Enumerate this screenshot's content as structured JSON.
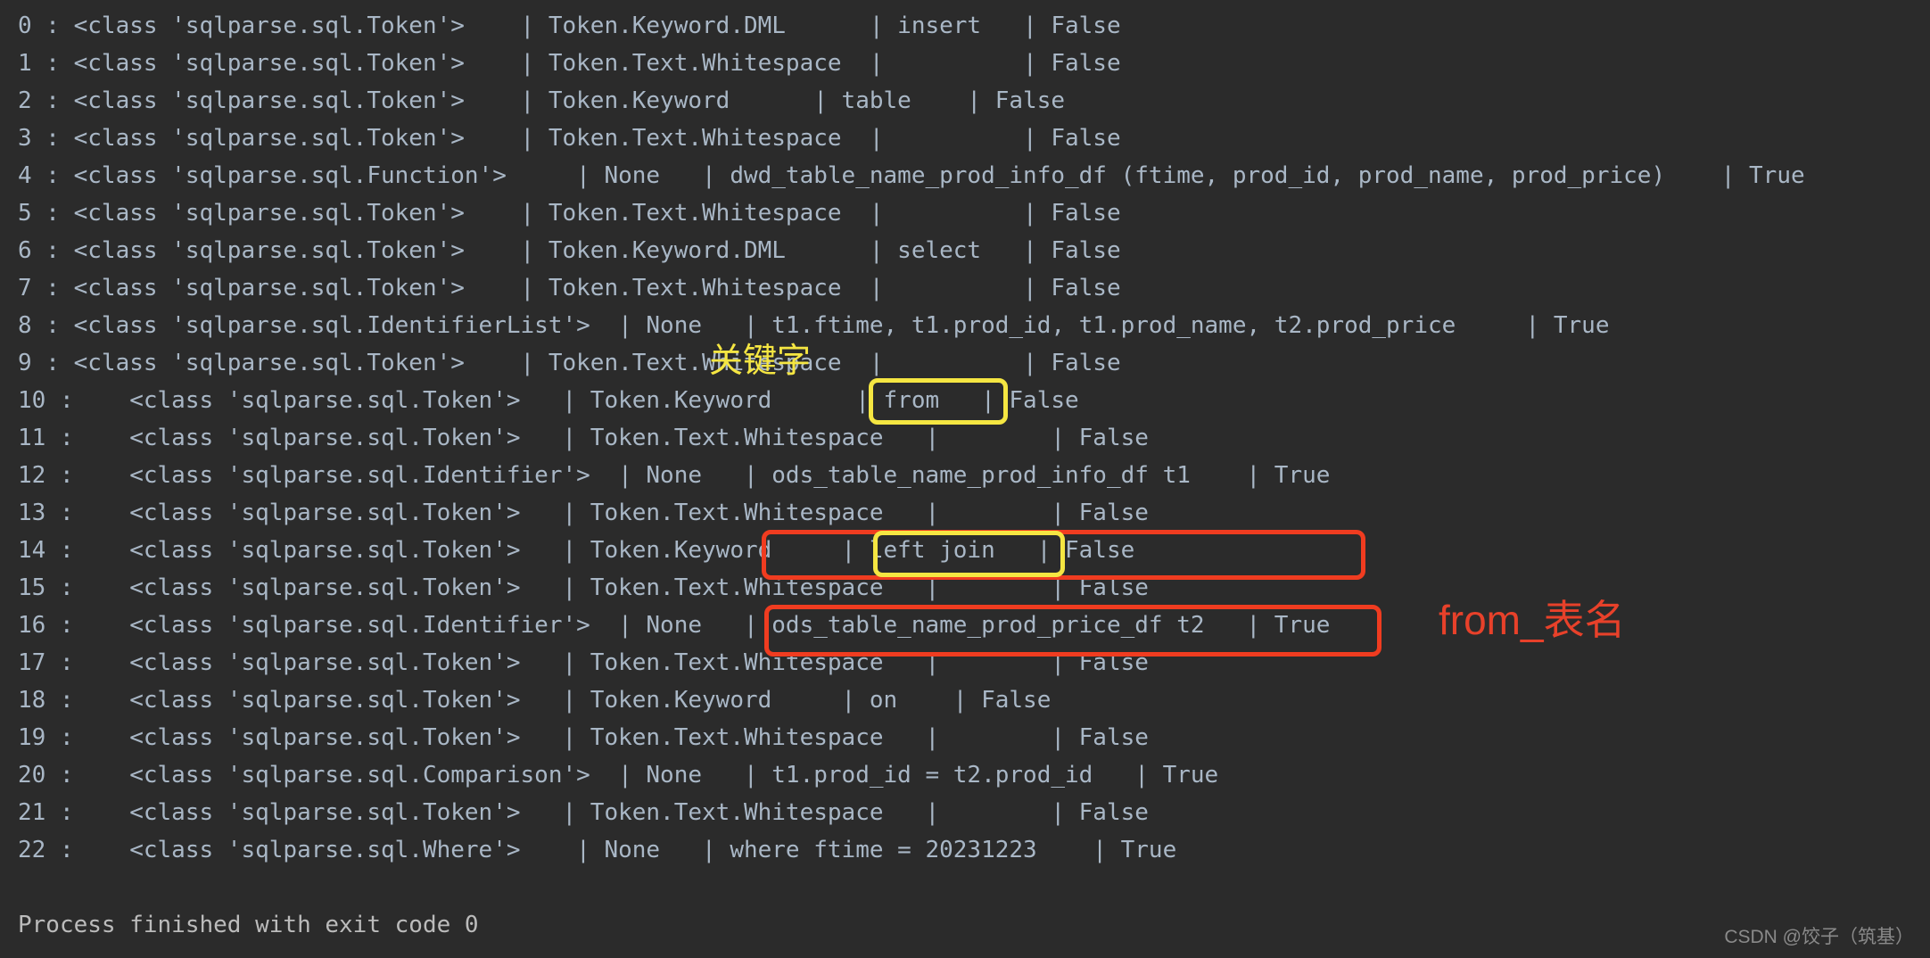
{
  "window": {
    "background_color": "#2b2b2b",
    "text_color": "#a9b7c6",
    "app_kind": "ide-run-console"
  },
  "console": {
    "lines": [
      "0 : <class 'sqlparse.sql.Token'>    | Token.Keyword.DML      | insert   | False",
      "1 : <class 'sqlparse.sql.Token'>    | Token.Text.Whitespace  |          | False",
      "2 : <class 'sqlparse.sql.Token'>    | Token.Keyword      | table    | False",
      "3 : <class 'sqlparse.sql.Token'>    | Token.Text.Whitespace  |          | False",
      "4 : <class 'sqlparse.sql.Function'>     | None   | dwd_table_name_prod_info_df (ftime, prod_id, prod_name, prod_price)    | True",
      "5 : <class 'sqlparse.sql.Token'>    | Token.Text.Whitespace  |          | False",
      "6 : <class 'sqlparse.sql.Token'>    | Token.Keyword.DML      | select   | False",
      "7 : <class 'sqlparse.sql.Token'>    | Token.Text.Whitespace  |          | False",
      "8 : <class 'sqlparse.sql.IdentifierList'>  | None   | t1.ftime, t1.prod_id, t1.prod_name, t2.prod_price     | True",
      "9 : <class 'sqlparse.sql.Token'>    | Token.Text.Whitespace  |          | False",
      "10 :    <class 'sqlparse.sql.Token'>   | Token.Keyword      | from   | False",
      "11 :    <class 'sqlparse.sql.Token'>   | Token.Text.Whitespace   |        | False",
      "12 :    <class 'sqlparse.sql.Identifier'>  | None   | ods_table_name_prod_info_df t1    | True",
      "13 :    <class 'sqlparse.sql.Token'>   | Token.Text.Whitespace   |        | False",
      "14 :    <class 'sqlparse.sql.Token'>   | Token.Keyword     | left join   | False",
      "15 :    <class 'sqlparse.sql.Token'>   | Token.Text.Whitespace   |        | False",
      "16 :    <class 'sqlparse.sql.Identifier'>  | None   | ods_table_name_prod_price_df t2   | True",
      "17 :    <class 'sqlparse.sql.Token'>   | Token.Text.Whitespace   |        | False",
      "18 :    <class 'sqlparse.sql.Token'>   | Token.Keyword     | on    | False",
      "19 :    <class 'sqlparse.sql.Token'>   | Token.Text.Whitespace   |        | False",
      "20 :    <class 'sqlparse.sql.Comparison'>  | None   | t1.prod_id = t2.prod_id   | True",
      "21 :    <class 'sqlparse.sql.Token'>   | Token.Text.Whitespace   |        | False",
      "22 :    <class 'sqlparse.sql.Where'>    | None   | where ftime = 20231223    | True"
    ],
    "blank_line": " ",
    "exit_message": "Process finished with exit code 0"
  },
  "annotations": {
    "keyword_label": "关键字",
    "keyword_label_color": "#f5e642",
    "from_table_label": "from_表名",
    "from_table_label_color": "#e8412a",
    "boxes": [
      {
        "name": "from-token-box",
        "color": "#f5e642",
        "target_text": "| from  |"
      },
      {
        "name": "identifier-t1-box",
        "color": "#f03c20",
        "target_text": "| ods_table_name_prod_info_df t1    | True"
      },
      {
        "name": "left-join-token-box",
        "color": "#f5e642",
        "target_text": "| left join"
      },
      {
        "name": "identifier-t2-box",
        "color": "#f03c20",
        "target_text": "| ods_table_name_prod_price_df t2   | True"
      }
    ]
  },
  "watermark": {
    "text": "CSDN @饺子（筑基）"
  }
}
